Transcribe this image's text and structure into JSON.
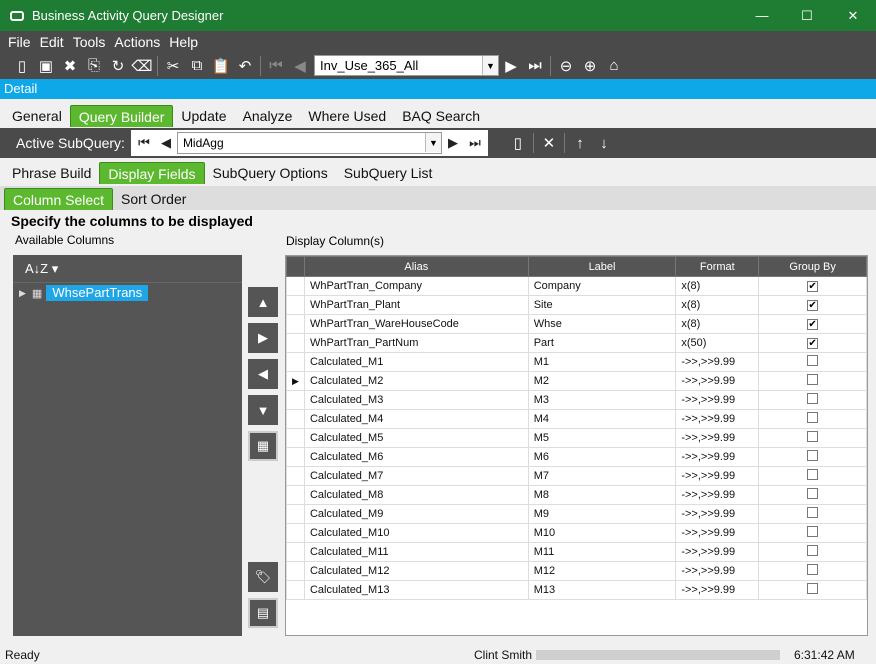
{
  "window": {
    "title": "Business Activity Query Designer",
    "min_glyph": "—",
    "max_glyph": "☐",
    "close_glyph": "✕"
  },
  "menu": [
    "File",
    "Edit",
    "Tools",
    "Actions",
    "Help"
  ],
  "toolbar": {
    "query_id": "Inv_Use_365_All",
    "icons": [
      "new-icon",
      "save-icon",
      "delete-icon",
      "attach-icon",
      "refresh-icon",
      "clear-icon",
      "cut-icon",
      "copy-icon",
      "paste-icon",
      "undo-icon"
    ]
  },
  "detail_label": "Detail",
  "main_tabs": [
    {
      "label": "General"
    },
    {
      "label": "Query Builder",
      "active": true
    },
    {
      "label": "Update"
    },
    {
      "label": "Analyze"
    },
    {
      "label": "Where Used"
    },
    {
      "label": "BAQ Search"
    }
  ],
  "subquery": {
    "label": "Active SubQuery:",
    "value": "MidAgg"
  },
  "sub_tabs": [
    {
      "label": "Phrase Build"
    },
    {
      "label": "Display Fields",
      "active": true
    },
    {
      "label": "SubQuery Options"
    },
    {
      "label": "SubQuery List"
    }
  ],
  "inner_tabs": [
    {
      "label": "Column Select",
      "active": true
    },
    {
      "label": "Sort Order"
    }
  ],
  "heading": "Specify the columns to be displayed",
  "available_label": "Available Columns",
  "display_label": "Display Column(s)",
  "tree": {
    "node": "WhsePartTrans"
  },
  "grid": {
    "columns": [
      "Alias",
      "Label",
      "Format",
      "Group By"
    ],
    "rows": [
      {
        "alias": "WhPartTran_Company",
        "label": "Company",
        "format": "x(8)",
        "group": true
      },
      {
        "alias": "WhPartTran_Plant",
        "label": "Site",
        "format": "x(8)",
        "group": true
      },
      {
        "alias": "WhPartTran_WareHouseCode",
        "label": "Whse",
        "format": "x(8)",
        "group": true
      },
      {
        "alias": "WhPartTran_PartNum",
        "label": "Part",
        "format": "x(50)",
        "group": true
      },
      {
        "alias": "Calculated_M1",
        "label": "M1",
        "format": "->>,>>9.99",
        "group": false
      },
      {
        "alias": "Calculated_M2",
        "label": "M2",
        "format": "->>,>>9.99",
        "group": false,
        "current": true
      },
      {
        "alias": "Calculated_M3",
        "label": "M3",
        "format": "->>,>>9.99",
        "group": false
      },
      {
        "alias": "Calculated_M4",
        "label": "M4",
        "format": "->>,>>9.99",
        "group": false
      },
      {
        "alias": "Calculated_M5",
        "label": "M5",
        "format": "->>,>>9.99",
        "group": false
      },
      {
        "alias": "Calculated_M6",
        "label": "M6",
        "format": "->>,>>9.99",
        "group": false
      },
      {
        "alias": "Calculated_M7",
        "label": "M7",
        "format": "->>,>>9.99",
        "group": false
      },
      {
        "alias": "Calculated_M8",
        "label": "M8",
        "format": "->>,>>9.99",
        "group": false
      },
      {
        "alias": "Calculated_M9",
        "label": "M9",
        "format": "->>,>>9.99",
        "group": false
      },
      {
        "alias": "Calculated_M10",
        "label": "M10",
        "format": "->>,>>9.99",
        "group": false
      },
      {
        "alias": "Calculated_M11",
        "label": "M11",
        "format": "->>,>>9.99",
        "group": false
      },
      {
        "alias": "Calculated_M12",
        "label": "M12",
        "format": "->>,>>9.99",
        "group": false
      },
      {
        "alias": "Calculated_M13",
        "label": "M13",
        "format": "->>,>>9.99",
        "group": false
      }
    ]
  },
  "status": {
    "text": "Ready",
    "user": "Clint Smith",
    "time": "6:31:42 AM"
  },
  "colors": {
    "title": "#1e7d32",
    "accent": "#5cb82e",
    "detail": "#0ea7e8",
    "dark": "#4a4a4a"
  }
}
